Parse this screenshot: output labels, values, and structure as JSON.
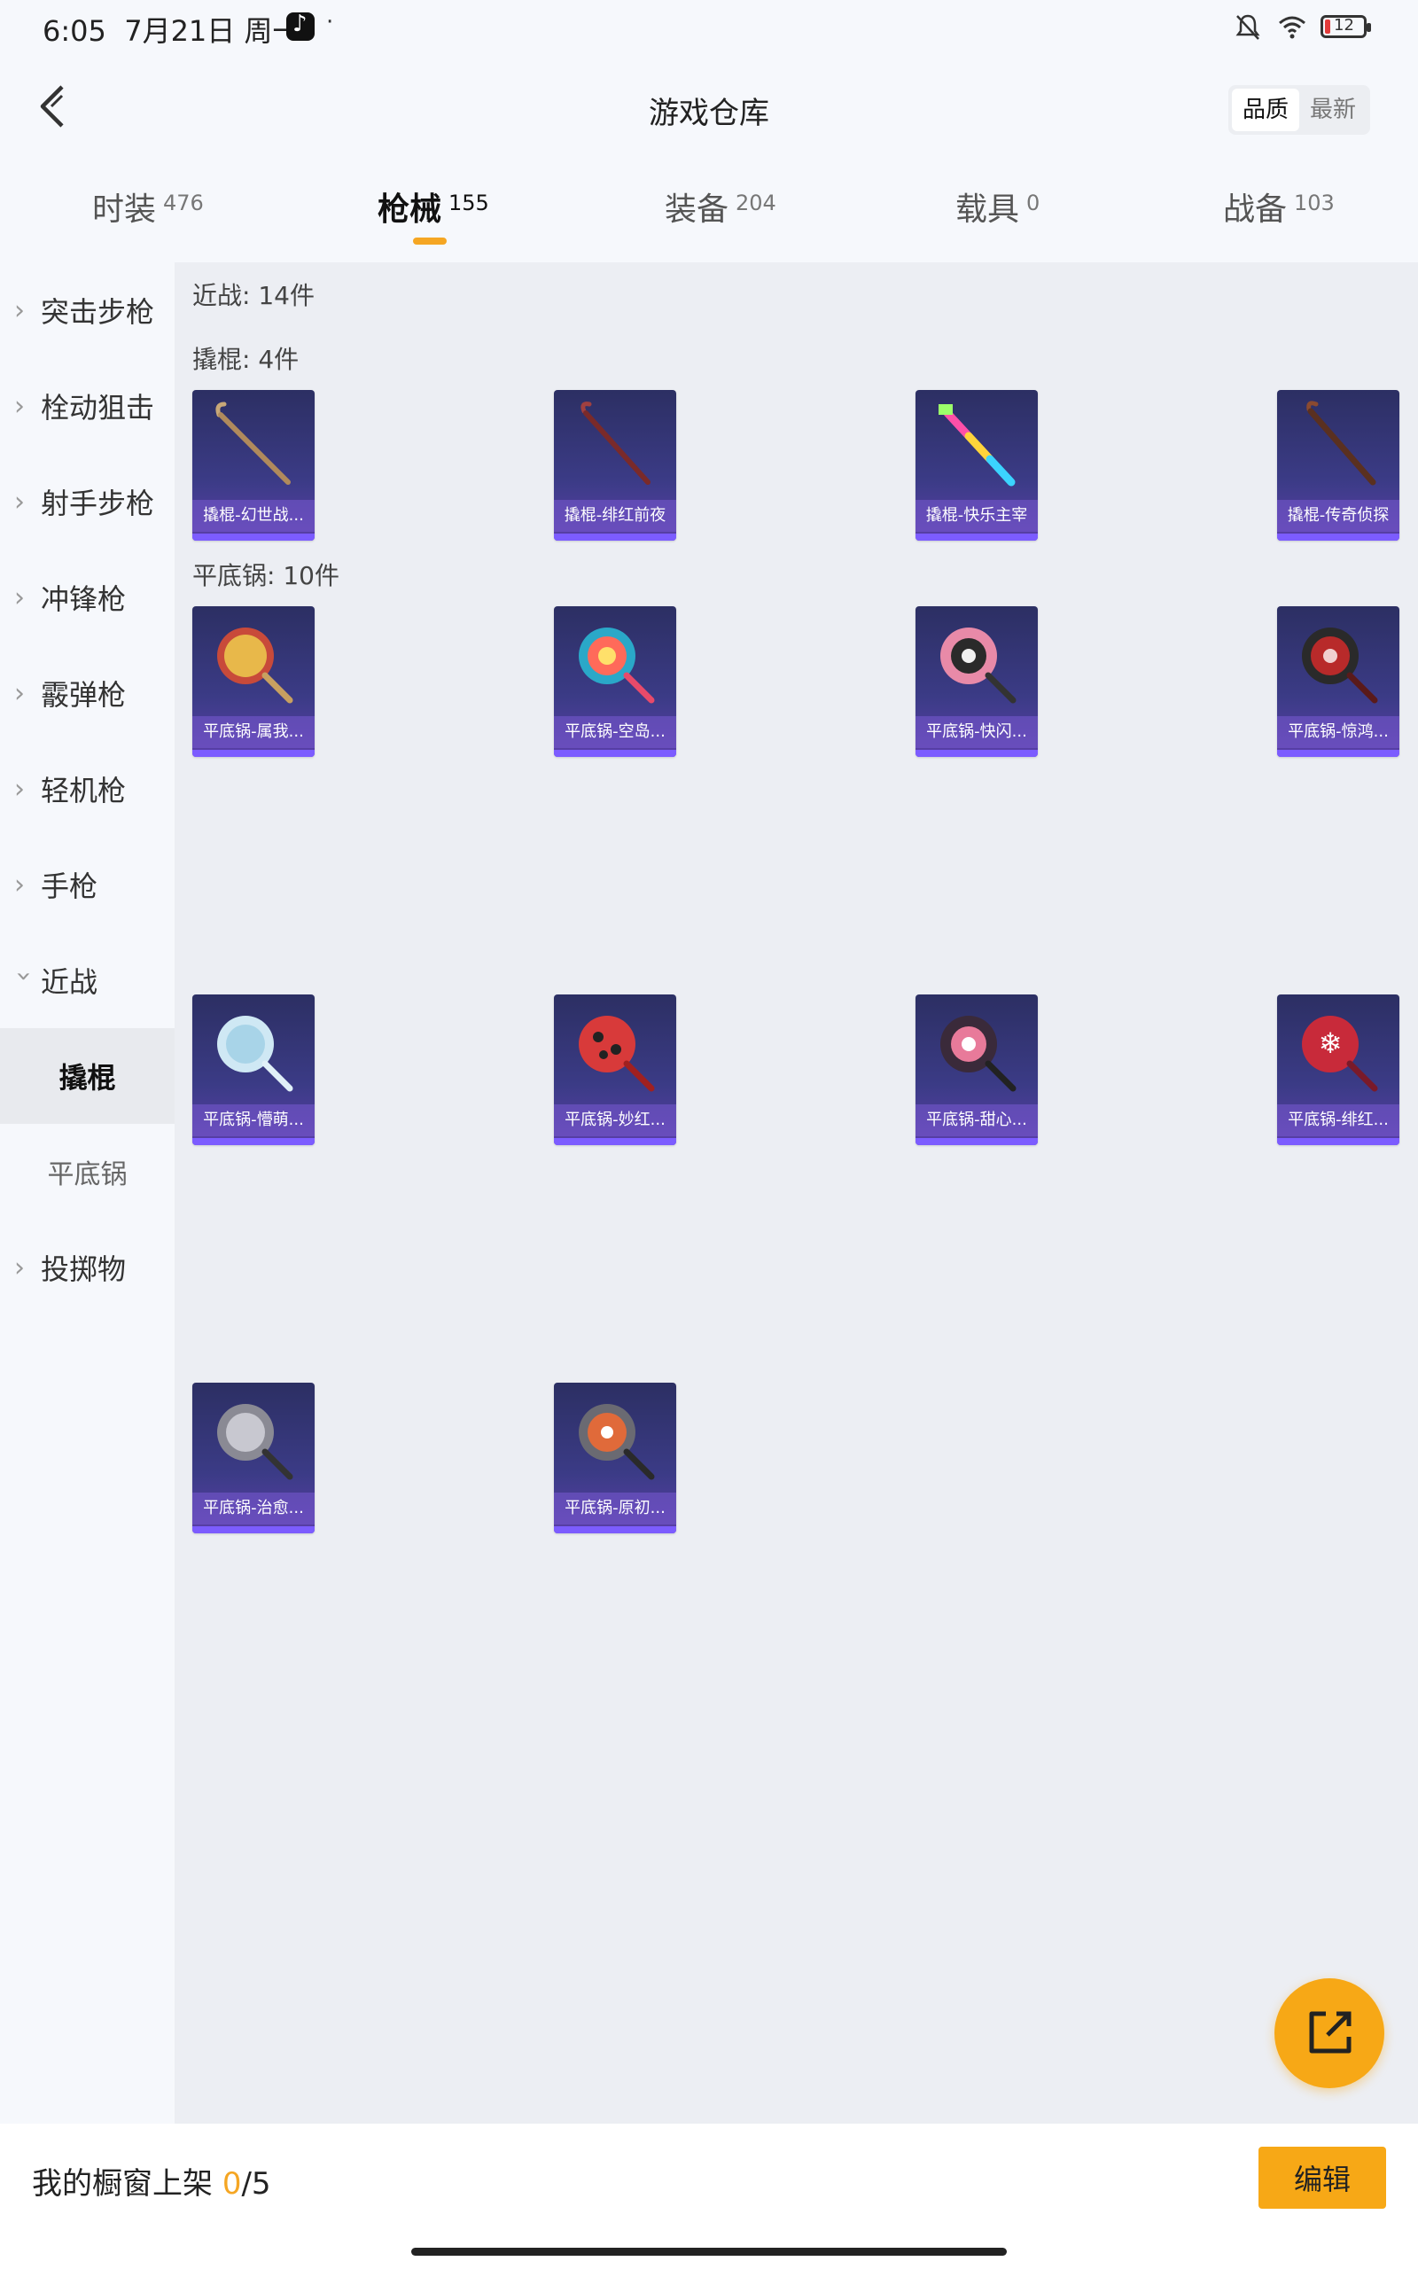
{
  "status": {
    "time": "6:05",
    "date": "7月21日 周一",
    "dot": "·",
    "battery": "12"
  },
  "header": {
    "title": "游戏仓库",
    "sort_options": [
      "品质",
      "最新"
    ]
  },
  "tabs": [
    {
      "label": "时装",
      "count": "476"
    },
    {
      "label": "枪械",
      "count": "155"
    },
    {
      "label": "装备",
      "count": "204"
    },
    {
      "label": "载具",
      "count": "0"
    },
    {
      "label": "战备",
      "count": "103"
    }
  ],
  "sidebar": {
    "items": [
      {
        "label": "突击步枪"
      },
      {
        "label": "栓动狙击"
      },
      {
        "label": "射手步枪"
      },
      {
        "label": "冲锋枪"
      },
      {
        "label": "霰弹枪"
      },
      {
        "label": "轻机枪"
      },
      {
        "label": "手枪"
      },
      {
        "label": "近战"
      },
      {
        "label": "撬棍"
      },
      {
        "label": "平底锅"
      },
      {
        "label": "投掷物"
      }
    ]
  },
  "content": {
    "section_label": "近战: 14件",
    "crowbar_label": "撬棍: 4件",
    "pan_label": "平底锅: 10件",
    "crowbars": [
      {
        "name": "撬棍-幻世战..."
      },
      {
        "name": "撬棍-绯红前夜"
      },
      {
        "name": "撬棍-快乐主宰"
      },
      {
        "name": "撬棍-传奇侦探"
      }
    ],
    "pans": [
      {
        "name": "平底锅-属我..."
      },
      {
        "name": "平底锅-空岛..."
      },
      {
        "name": "平底锅-快闪..."
      },
      {
        "name": "平底锅-惊鸿..."
      },
      {
        "name": "平底锅-懵萌..."
      },
      {
        "name": "平底锅-妙红..."
      },
      {
        "name": "平底锅-甜心..."
      },
      {
        "name": "平底锅-绯红..."
      },
      {
        "name": "平底锅-治愈..."
      },
      {
        "name": "平底锅-原初..."
      }
    ]
  },
  "bottom": {
    "shelf_prefix": "我的橱窗上架 ",
    "shelf_count": "0",
    "shelf_total": "/5",
    "edit_label": "编辑"
  },
  "colors": {
    "accent": "#f7a816",
    "card_bg": "#3b3b86",
    "card_bar": "#7c5cff"
  }
}
